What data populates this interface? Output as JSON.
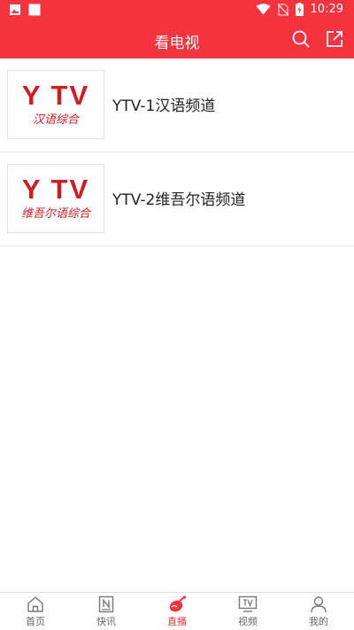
{
  "status_bar": {
    "time": "10:29"
  },
  "app_bar": {
    "title": "看电视"
  },
  "channels": [
    {
      "name": "YTV-1汉语频道",
      "thumb_logo": "Y TV",
      "thumb_sub": "汉语综合"
    },
    {
      "name": "YTV-2维吾尔语频道",
      "thumb_logo": "Y TV",
      "thumb_sub": "维吾尔语综合"
    }
  ],
  "bottom_nav": [
    {
      "label": "首页",
      "icon": "home-icon",
      "active": false
    },
    {
      "label": "快讯",
      "icon": "news-icon",
      "active": false
    },
    {
      "label": "直播",
      "icon": "live-icon",
      "active": true
    },
    {
      "label": "视频",
      "icon": "tv-icon",
      "active": false
    },
    {
      "label": "我的",
      "icon": "profile-icon",
      "active": false
    }
  ],
  "colors": {
    "brand": "#f5333f",
    "logo_red": "#d71921"
  }
}
